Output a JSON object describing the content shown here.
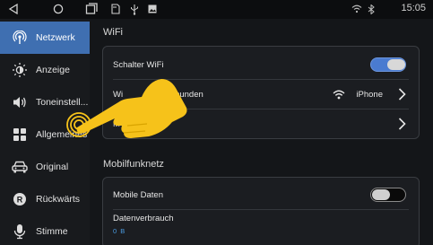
{
  "statusbar": {
    "icons": [
      "back-icon",
      "home-icon",
      "recents-icon",
      "sd-card-icon",
      "usb-icon",
      "gallery-icon",
      "wifi-signal-icon",
      "bluetooth-icon"
    ],
    "time": "15:05"
  },
  "sidebar": {
    "items": [
      {
        "label": "Netzwerk",
        "icon": "antenna-icon",
        "active": true
      },
      {
        "label": "Anzeige",
        "icon": "brightness-icon",
        "active": false
      },
      {
        "label": "Toneinstell...",
        "icon": "speaker-icon",
        "active": false
      },
      {
        "label": "Allgemeines",
        "icon": "grid-icon",
        "active": false
      },
      {
        "label": "Original",
        "icon": "car-icon",
        "active": false
      },
      {
        "label": "Rückwärts",
        "icon": "reverse-icon",
        "active": false
      },
      {
        "label": "Stimme",
        "icon": "microphone-icon",
        "active": false
      }
    ]
  },
  "main": {
    "wifi_section": {
      "title": "WiFi",
      "switch_label": "Schalter WiFi",
      "switch_on": true,
      "connected_label": "Wi",
      "connected_label_tail": "bunden",
      "connected_value": "iPhone",
      "third_row_label": "M"
    },
    "mobile_section": {
      "title": "Mobilfunknetz",
      "mobile_data_label": "Mobile Daten",
      "mobile_data_on": false,
      "usage_label": "Datenverbrauch",
      "usage_value": "0 B"
    }
  },
  "colors": {
    "accent": "#3f6fb1",
    "toggle_on": "#4a7bd0",
    "pointer_hand": "#f6c21a"
  }
}
